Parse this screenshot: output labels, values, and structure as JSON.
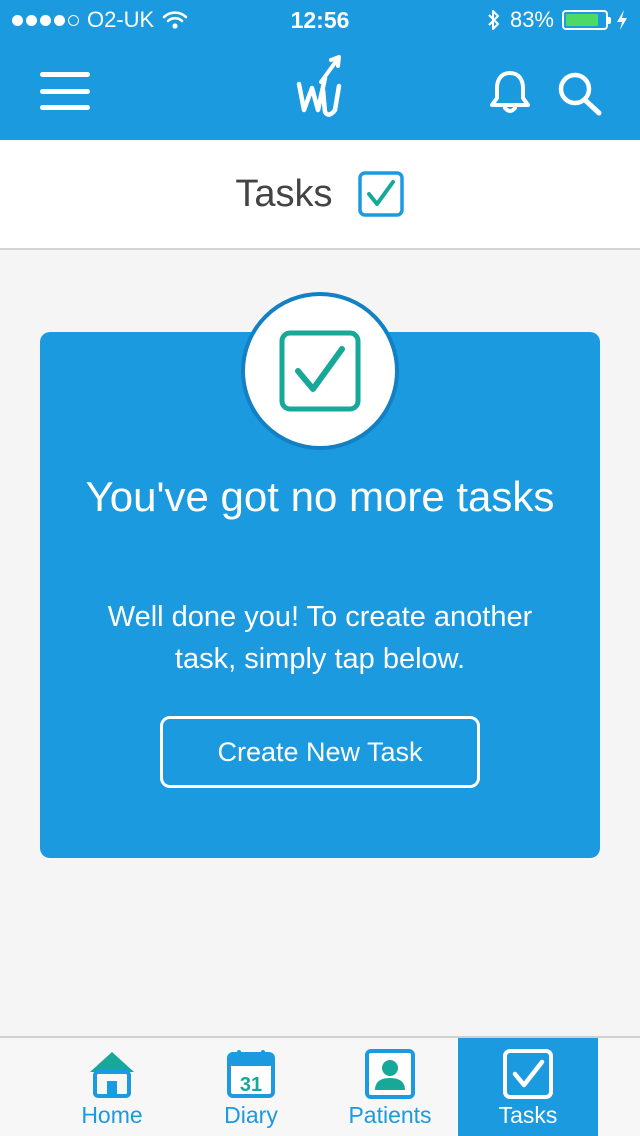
{
  "status_bar": {
    "carrier": "O2-UK",
    "time": "12:56",
    "battery": "83%",
    "battery_level": 0.83
  },
  "nav": {
    "menu_icon": "hamburger-menu-icon",
    "logo_icon": "app-logo",
    "bell_icon": "bell-icon",
    "search_icon": "search-icon"
  },
  "page": {
    "title": "Tasks"
  },
  "empty_state": {
    "heading": "You've got no more tasks",
    "body": "Well done you! To create another task, simply tap below.",
    "button_label": "Create New Task"
  },
  "tabs": [
    {
      "label": "Home",
      "icon": "home-icon",
      "active": false
    },
    {
      "label": "Diary",
      "icon": "calendar-icon",
      "calendar_day": "31",
      "active": false
    },
    {
      "label": "Patients",
      "icon": "patient-icon",
      "active": false
    },
    {
      "label": "Tasks",
      "icon": "checkbox-icon",
      "active": true
    }
  ],
  "colors": {
    "primary": "#1b9ae0",
    "accent_teal": "#17a89a",
    "battery_green": "#4cd964"
  }
}
